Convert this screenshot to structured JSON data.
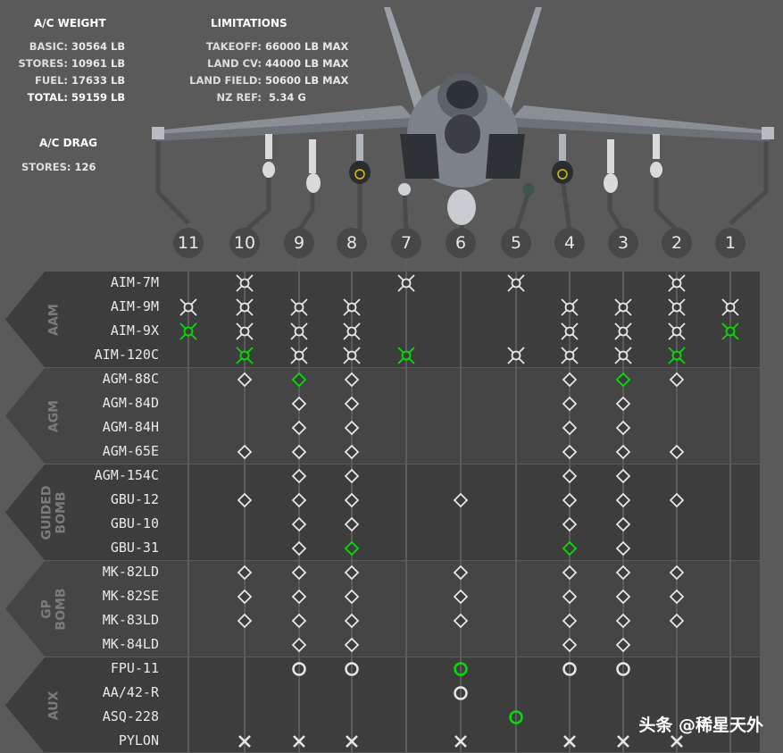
{
  "weight": {
    "title": "A/C WEIGHT",
    "rows": [
      {
        "label": "BASIC:",
        "value": "30564 LB"
      },
      {
        "label": "STORES:",
        "value": "10961 LB"
      },
      {
        "label": "FUEL:",
        "value": "17633 LB"
      },
      {
        "label": "TOTAL:",
        "value": "59159 LB"
      }
    ]
  },
  "limits": {
    "title": "LIMITATIONS",
    "rows": [
      {
        "label": "TAKEOFF:",
        "value": "66000",
        "unit": " LB MAX",
        "highlight": false
      },
      {
        "label": "LAND CV:",
        "value": "44000",
        "unit": " LB MAX",
        "highlight": true
      },
      {
        "label": "LAND FIELD:",
        "value": "50600",
        "unit": " LB MAX",
        "highlight": true
      },
      {
        "label": "NZ REF:",
        "value": "5.34 G",
        "unit": "",
        "highlight": false
      }
    ]
  },
  "drag": {
    "title": "A/C DRAG",
    "label": "STORES:",
    "value": "126"
  },
  "stations": [
    "11",
    "10",
    "9",
    "8",
    "7",
    "6",
    "5",
    "4",
    "3",
    "2",
    "1"
  ],
  "categories": [
    {
      "lines": [
        "AAM"
      ],
      "rows": [
        0,
        3
      ]
    },
    {
      "lines": [
        "AGM"
      ],
      "rows": [
        4,
        7
      ]
    },
    {
      "lines": [
        "GUIDED",
        "BOMB"
      ],
      "rows": [
        8,
        11
      ]
    },
    {
      "lines": [
        "GP",
        "BOMB"
      ],
      "rows": [
        12,
        15
      ]
    },
    {
      "lines": [
        "AUX"
      ],
      "rows": [
        16,
        19
      ]
    }
  ],
  "weapons": [
    {
      "name": "AIM-7M",
      "icon": "x-circle-icon",
      "avail": [
        10,
        7,
        5,
        2
      ],
      "sel": []
    },
    {
      "name": "AIM-9M",
      "icon": "x-circle-icon",
      "avail": [
        11,
        10,
        9,
        8,
        4,
        3,
        2,
        1
      ],
      "sel": []
    },
    {
      "name": "AIM-9X",
      "icon": "x-circle-icon",
      "avail": [
        10,
        9,
        8,
        4,
        3,
        2
      ],
      "sel": [
        11,
        1
      ]
    },
    {
      "name": "AIM-120C",
      "icon": "x-circle-icon",
      "avail": [
        9,
        8,
        5,
        4,
        3
      ],
      "sel": [
        10,
        7,
        2
      ]
    },
    {
      "name": "AGM-88C",
      "icon": "diamond-icon",
      "avail": [
        10,
        8,
        4,
        2
      ],
      "sel": [
        9,
        3
      ]
    },
    {
      "name": "AGM-84D",
      "icon": "diamond-icon",
      "avail": [
        9,
        8,
        4,
        3
      ],
      "sel": []
    },
    {
      "name": "AGM-84H",
      "icon": "diamond-icon",
      "avail": [
        9,
        8,
        4,
        3
      ],
      "sel": []
    },
    {
      "name": "AGM-65E",
      "icon": "diamond-icon",
      "avail": [
        10,
        9,
        8,
        4,
        3,
        2
      ],
      "sel": []
    },
    {
      "name": "AGM-154C",
      "icon": "diamond-icon",
      "avail": [
        9,
        8,
        4,
        3
      ],
      "sel": []
    },
    {
      "name": "GBU-12",
      "icon": "diamond-icon",
      "avail": [
        10,
        9,
        8,
        6,
        4,
        3,
        2
      ],
      "sel": []
    },
    {
      "name": "GBU-10",
      "icon": "diamond-icon",
      "avail": [
        9,
        8,
        4,
        3
      ],
      "sel": []
    },
    {
      "name": "GBU-31",
      "icon": "diamond-icon",
      "avail": [
        9,
        3
      ],
      "sel": [
        8,
        4
      ]
    },
    {
      "name": "MK-82LD",
      "icon": "diamond-icon",
      "avail": [
        10,
        9,
        8,
        6,
        4,
        3,
        2
      ],
      "sel": []
    },
    {
      "name": "MK-82SE",
      "icon": "diamond-icon",
      "avail": [
        10,
        9,
        8,
        6,
        4,
        3,
        2
      ],
      "sel": []
    },
    {
      "name": "MK-83LD",
      "icon": "diamond-icon",
      "avail": [
        10,
        9,
        8,
        6,
        4,
        3,
        2
      ],
      "sel": []
    },
    {
      "name": "MK-84LD",
      "icon": "diamond-icon",
      "avail": [
        9,
        8,
        4,
        3
      ],
      "sel": []
    },
    {
      "name": "FPU-11",
      "icon": "ring-icon",
      "avail": [
        9,
        8,
        4,
        3
      ],
      "sel": [
        6
      ]
    },
    {
      "name": "AA/42-R",
      "icon": "ring-icon",
      "avail": [
        6
      ],
      "sel": []
    },
    {
      "name": "ASQ-228",
      "icon": "ring-icon",
      "avail": [],
      "sel": [
        5
      ]
    },
    {
      "name": "PYLON",
      "icon": "cross-icon",
      "avail": [
        10,
        9,
        8,
        6,
        4,
        3,
        2
      ],
      "sel": []
    }
  ],
  "colors": {
    "selected": "#00e000",
    "available": "#e6e6e6",
    "highlight": "#ffea00"
  },
  "watermark": "头条 @稀星天外"
}
